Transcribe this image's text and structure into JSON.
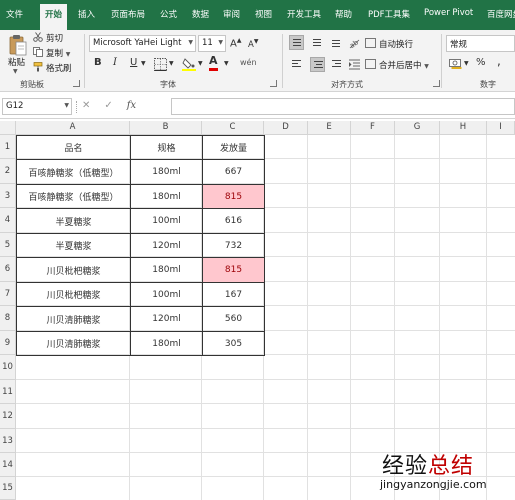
{
  "tabs": [
    "文件",
    "开始",
    "插入",
    "页面布局",
    "公式",
    "数据",
    "审阅",
    "视图",
    "开发工具",
    "帮助",
    "PDF工具集",
    "Power Pivot",
    "百度网盘"
  ],
  "ribbon": {
    "clipboard": {
      "paste_label": "粘贴",
      "cut_label": "剪切",
      "copy_label": "复制",
      "format_painter_label": "格式刷",
      "group_label": "剪贴板"
    },
    "font": {
      "font_name": "Microsoft YaHei Light",
      "font_size": "11",
      "bold": "B",
      "italic": "I",
      "underline": "U",
      "font_color_glyph": "A",
      "group_label": "字体"
    },
    "alignment": {
      "wrap_text_label": "自动换行",
      "merge_center_label": "合并后居中",
      "group_label": "对齐方式"
    },
    "number": {
      "format": "常规",
      "percent": "%",
      "comma": ",",
      "group_label": "数字"
    }
  },
  "formula_bar": {
    "name_box": "G12",
    "cancel": "✕",
    "enter": "✓",
    "fx": "fx",
    "value": ""
  },
  "grid": {
    "columns": [
      "A",
      "B",
      "C",
      "D",
      "E",
      "F",
      "G",
      "H",
      "I"
    ],
    "rows": [
      "1",
      "2",
      "3",
      "4",
      "5",
      "6",
      "7",
      "8",
      "9",
      "10",
      "11",
      "12",
      "13",
      "14",
      "15"
    ]
  },
  "table": {
    "headers": [
      "品名",
      "规格",
      "发放量"
    ],
    "rows": [
      {
        "name": "百咳静糖浆（低糖型）",
        "spec": "180ml",
        "qty": "667",
        "highlight": false
      },
      {
        "name": "百咳静糖浆（低糖型）",
        "spec": "180ml",
        "qty": "815",
        "highlight": true
      },
      {
        "name": "半夏糖浆",
        "spec": "100ml",
        "qty": "616",
        "highlight": false
      },
      {
        "name": "半夏糖浆",
        "spec": "120ml",
        "qty": "732",
        "highlight": false
      },
      {
        "name": "川贝枇杷糖浆",
        "spec": "180ml",
        "qty": "815",
        "highlight": true
      },
      {
        "name": "川贝枇杷糖浆",
        "spec": "100ml",
        "qty": "167",
        "highlight": false
      },
      {
        "name": "川贝清肺糖浆",
        "spec": "120ml",
        "qty": "560",
        "highlight": false
      },
      {
        "name": "川贝清肺糖浆",
        "spec": "180ml",
        "qty": "305",
        "highlight": false
      }
    ]
  },
  "watermark": {
    "cn_black": "经验",
    "cn_red": "总结",
    "url": "jingyanzongjie.com"
  },
  "colors": {
    "accent": "#217346",
    "duplicate_fill": "#ffc7ce",
    "duplicate_text": "#9c0006"
  }
}
